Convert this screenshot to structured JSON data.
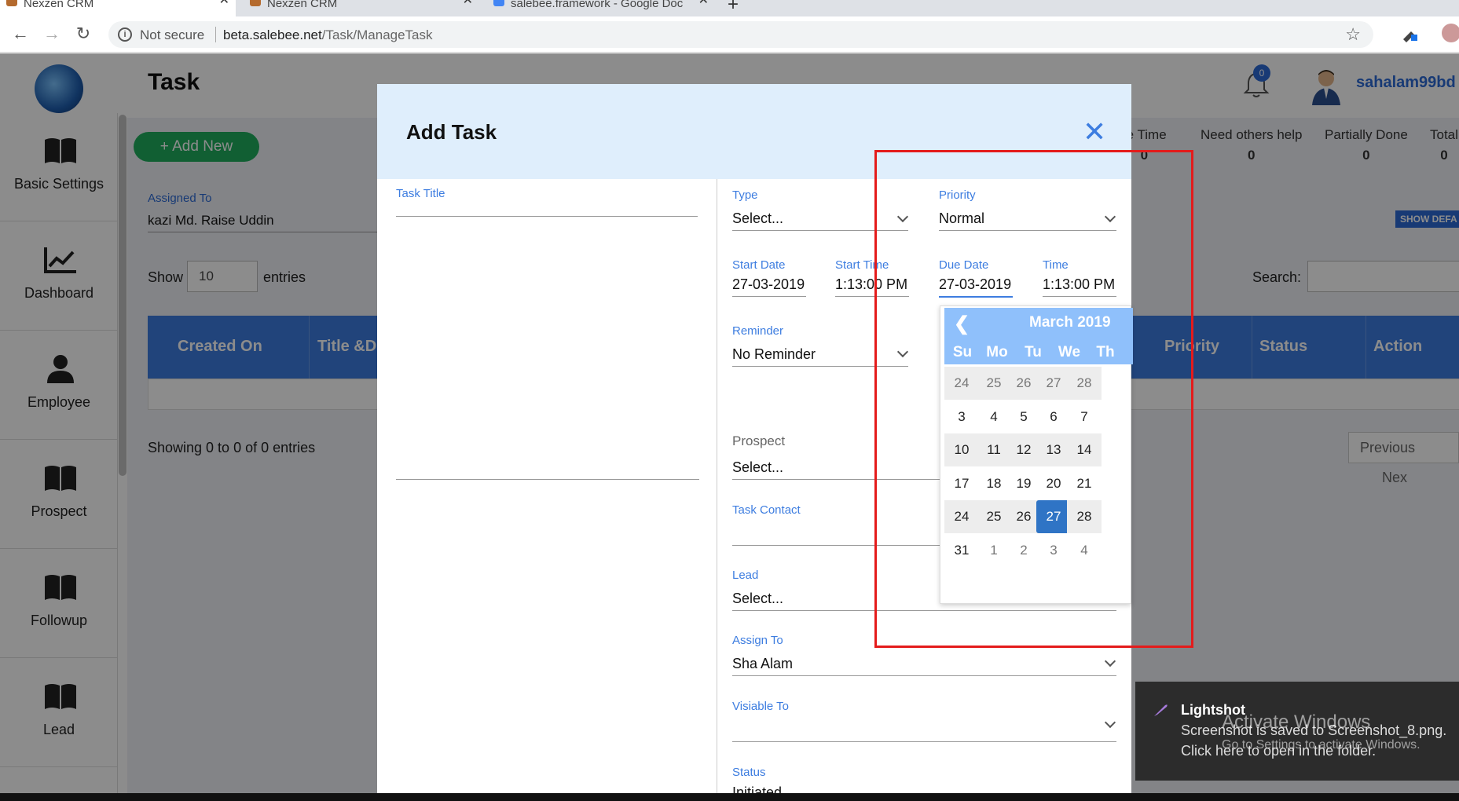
{
  "browser": {
    "tabs": [
      {
        "label": "Nexzen CRM"
      },
      {
        "label": "Nexzen CRM"
      },
      {
        "label": "salebee.framework - Google Doc"
      }
    ],
    "not_secure": "Not secure",
    "url_host": "beta.salebee.net",
    "url_path": "/Task/ManageTask"
  },
  "header": {
    "page_title": "Task",
    "notification_count": "0",
    "username": "sahalam99bd"
  },
  "sidebar": {
    "items": [
      {
        "label": "Basic Settings",
        "icon": "book-icon"
      },
      {
        "label": "Dashboard",
        "icon": "chart-icon"
      },
      {
        "label": "Employee",
        "icon": "user-icon"
      },
      {
        "label": "Prospect",
        "icon": "book-icon"
      },
      {
        "label": "Followup",
        "icon": "book-icon"
      },
      {
        "label": "Lead",
        "icon": "book-icon"
      }
    ]
  },
  "page": {
    "add_new": "+ Add New",
    "assigned_to_label": "Assigned To",
    "assigned_to_value": "kazi Md. Raise Uddin",
    "stats": [
      {
        "label": "re Time",
        "value": "0"
      },
      {
        "label": "Need others help",
        "value": "0"
      },
      {
        "label": "Partially Done",
        "value": "0"
      },
      {
        "label": "Total",
        "value": "0"
      }
    ],
    "show_default": "SHOW DEFA",
    "show_label": "Show",
    "show_value": "10",
    "entries_label": "entries",
    "search_label": "Search:",
    "table_headers": [
      "Created On",
      "Title &D",
      "Priority",
      "Status",
      "Action"
    ],
    "showing": "Showing 0 to 0 of 0 entries",
    "prev": "Previous",
    "next": "Nex"
  },
  "modal": {
    "title": "Add Task",
    "task_title_label": "Task Title",
    "type_label": "Type",
    "type_value": "Select...",
    "priority_label": "Priority",
    "priority_value": "Normal",
    "start_date_label": "Start Date",
    "start_date_value": "27-03-2019",
    "start_time_label": "Start Time",
    "start_time_value": "1:13:00 PM",
    "due_date_label": "Due Date",
    "due_date_value": "27-03-2019",
    "time_label": "Time",
    "time_value": "1:13:00 PM",
    "reminder_label": "Reminder",
    "reminder_value": "No Reminder",
    "prospect_label": "Prospect",
    "prospect_value": "Select...",
    "task_contact_label": "Task Contact",
    "lead_label": "Lead",
    "lead_value": "Select...",
    "assign_to_label": "Assign To",
    "assign_to_value": "Sha Alam",
    "visible_to_label": "Visiable To",
    "status_label": "Status",
    "status_value": "Initiated"
  },
  "calendar": {
    "month": "March 2019",
    "weekdays": [
      "Su",
      "Mo",
      "Tu",
      "We",
      "Th"
    ],
    "weeks": [
      [
        "24",
        "25",
        "26",
        "27",
        "28"
      ],
      [
        "3",
        "4",
        "5",
        "6",
        "7"
      ],
      [
        "10",
        "11",
        "12",
        "13",
        "14"
      ],
      [
        "17",
        "18",
        "19",
        "20",
        "21"
      ],
      [
        "24",
        "25",
        "26",
        "27",
        "28"
      ],
      [
        "31",
        "1",
        "2",
        "3",
        "4"
      ]
    ],
    "selected": "27"
  },
  "toast": {
    "title": "Lightshot",
    "line1": "Screenshot is saved to Screenshot_8.png.",
    "line2": "Click here to open in the folder."
  },
  "watermark": {
    "line1": "Activate Windows",
    "line2": "Go to Settings to activate Windows."
  },
  "colors": {
    "accent": "#3d7de0",
    "add_new": "#1fae5e",
    "highlight_box": "#e41b1b",
    "calendar_header": "#8fc0fb",
    "calendar_selected": "#2f74c5"
  }
}
